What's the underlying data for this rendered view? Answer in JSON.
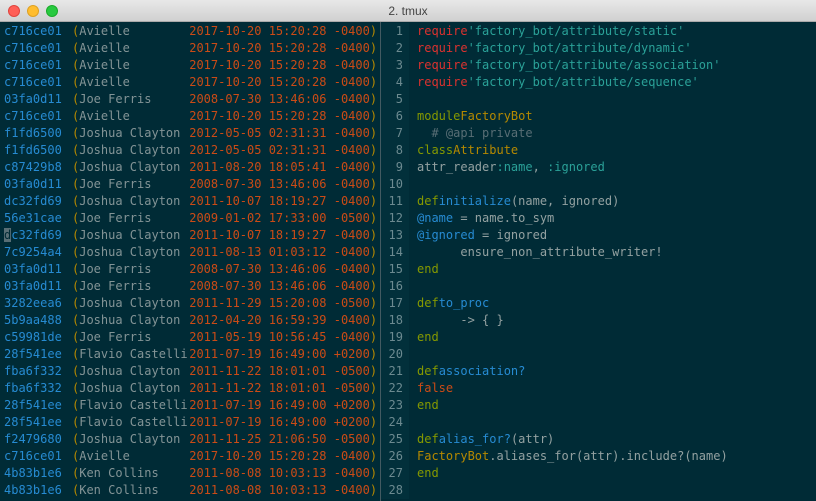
{
  "window": {
    "title": "2. tmux"
  },
  "blame": [
    {
      "hash": "c716ce01",
      "author": "Avielle",
      "ts": "2017-10-20 15:20:28 -0400"
    },
    {
      "hash": "c716ce01",
      "author": "Avielle",
      "ts": "2017-10-20 15:20:28 -0400"
    },
    {
      "hash": "c716ce01",
      "author": "Avielle",
      "ts": "2017-10-20 15:20:28 -0400"
    },
    {
      "hash": "c716ce01",
      "author": "Avielle",
      "ts": "2017-10-20 15:20:28 -0400"
    },
    {
      "hash": "03fa0d11",
      "author": "Joe Ferris",
      "ts": "2008-07-30 13:46:06 -0400"
    },
    {
      "hash": "c716ce01",
      "author": "Avielle",
      "ts": "2017-10-20 15:20:28 -0400"
    },
    {
      "hash": "f1fd6500",
      "author": "Joshua Clayton",
      "ts": "2012-05-05 02:31:31 -0400"
    },
    {
      "hash": "f1fd6500",
      "author": "Joshua Clayton",
      "ts": "2012-05-05 02:31:31 -0400"
    },
    {
      "hash": "c87429b8",
      "author": "Joshua Clayton",
      "ts": "2011-08-20 18:05:41 -0400"
    },
    {
      "hash": "03fa0d11",
      "author": "Joe Ferris",
      "ts": "2008-07-30 13:46:06 -0400"
    },
    {
      "hash": "dc32fd69",
      "author": "Joshua Clayton",
      "ts": "2011-10-07 18:19:27 -0400"
    },
    {
      "hash": "56e31cae",
      "author": "Joe Ferris",
      "ts": "2009-01-02 17:33:00 -0500"
    },
    {
      "hash": "dc32fd69",
      "author": "Joshua Clayton",
      "ts": "2011-10-07 18:19:27 -0400",
      "cursor": true
    },
    {
      "hash": "7c9254a4",
      "author": "Joshua Clayton",
      "ts": "2011-08-13 01:03:12 -0400"
    },
    {
      "hash": "03fa0d11",
      "author": "Joe Ferris",
      "ts": "2008-07-30 13:46:06 -0400"
    },
    {
      "hash": "03fa0d11",
      "author": "Joe Ferris",
      "ts": "2008-07-30 13:46:06 -0400"
    },
    {
      "hash": "3282eea6",
      "author": "Joshua Clayton",
      "ts": "2011-11-29 15:20:08 -0500"
    },
    {
      "hash": "5b9aa488",
      "author": "Joshua Clayton",
      "ts": "2012-04-20 16:59:39 -0400"
    },
    {
      "hash": "c59981de",
      "author": "Joe Ferris",
      "ts": "2011-05-19 10:56:45 -0400"
    },
    {
      "hash": "28f541ee",
      "author": "Flavio Castelli",
      "ts": "2011-07-19 16:49:00 +0200"
    },
    {
      "hash": "fba6f332",
      "author": "Joshua Clayton",
      "ts": "2011-11-22 18:01:01 -0500"
    },
    {
      "hash": "fba6f332",
      "author": "Joshua Clayton",
      "ts": "2011-11-22 18:01:01 -0500"
    },
    {
      "hash": "28f541ee",
      "author": "Flavio Castelli",
      "ts": "2011-07-19 16:49:00 +0200"
    },
    {
      "hash": "28f541ee",
      "author": "Flavio Castelli",
      "ts": "2011-07-19 16:49:00 +0200"
    },
    {
      "hash": "f2479680",
      "author": "Joshua Clayton",
      "ts": "2011-11-25 21:06:50 -0500"
    },
    {
      "hash": "c716ce01",
      "author": "Avielle",
      "ts": "2017-10-20 15:20:28 -0400"
    },
    {
      "hash": "4b83b1e6",
      "author": "Ken Collins",
      "ts": "2011-08-08 10:03:13 -0400"
    },
    {
      "hash": "4b83b1e6",
      "author": "Ken Collins",
      "ts": "2011-08-08 10:03:13 -0400"
    }
  ],
  "code": [
    {
      "n": 1,
      "t": "require",
      "str": "'factory_bot/attribute/static'"
    },
    {
      "n": 2,
      "t": "require",
      "str": "'factory_bot/attribute/dynamic'"
    },
    {
      "n": 3,
      "t": "require",
      "str": "'factory_bot/attribute/association'"
    },
    {
      "n": 4,
      "t": "require",
      "str": "'factory_bot/attribute/sequence'"
    },
    {
      "n": 5,
      "t": "blank"
    },
    {
      "n": 6,
      "t": "module",
      "name": "FactoryBot"
    },
    {
      "n": 7,
      "t": "comment",
      "text": "  # @api private"
    },
    {
      "n": 8,
      "t": "class",
      "name": "Attribute"
    },
    {
      "n": 9,
      "t": "attr_reader",
      "syms": [
        ":name",
        ":ignored"
      ]
    },
    {
      "n": 10,
      "t": "blank"
    },
    {
      "n": 11,
      "t": "def",
      "name": "initialize",
      "args": "(name, ignored)"
    },
    {
      "n": 12,
      "t": "assign",
      "lhs": "@name",
      "rhs": "name.to_sym"
    },
    {
      "n": 13,
      "t": "assign",
      "lhs": "@ignored",
      "rhs": "ignored"
    },
    {
      "n": 14,
      "t": "plain",
      "text": "      ensure_non_attribute_writer!"
    },
    {
      "n": 15,
      "t": "end",
      "indent": "    "
    },
    {
      "n": 16,
      "t": "blank"
    },
    {
      "n": 17,
      "t": "def",
      "name": "to_proc",
      "args": ""
    },
    {
      "n": 18,
      "t": "plain",
      "text": "      -> { }"
    },
    {
      "n": 19,
      "t": "end",
      "indent": "    "
    },
    {
      "n": 20,
      "t": "blank"
    },
    {
      "n": 21,
      "t": "def",
      "name": "association?",
      "args": ""
    },
    {
      "n": 22,
      "t": "false"
    },
    {
      "n": 23,
      "t": "end",
      "indent": "    "
    },
    {
      "n": 24,
      "t": "blank"
    },
    {
      "n": 25,
      "t": "def",
      "name": "alias_for?",
      "args": "(attr)"
    },
    {
      "n": 26,
      "t": "alias_call"
    },
    {
      "n": 27,
      "t": "end",
      "indent": "    "
    },
    {
      "n": 28,
      "t": "blank"
    }
  ],
  "alias_call": {
    "const": "FactoryBot",
    "rest": ".aliases_for(attr).include?(name)"
  }
}
